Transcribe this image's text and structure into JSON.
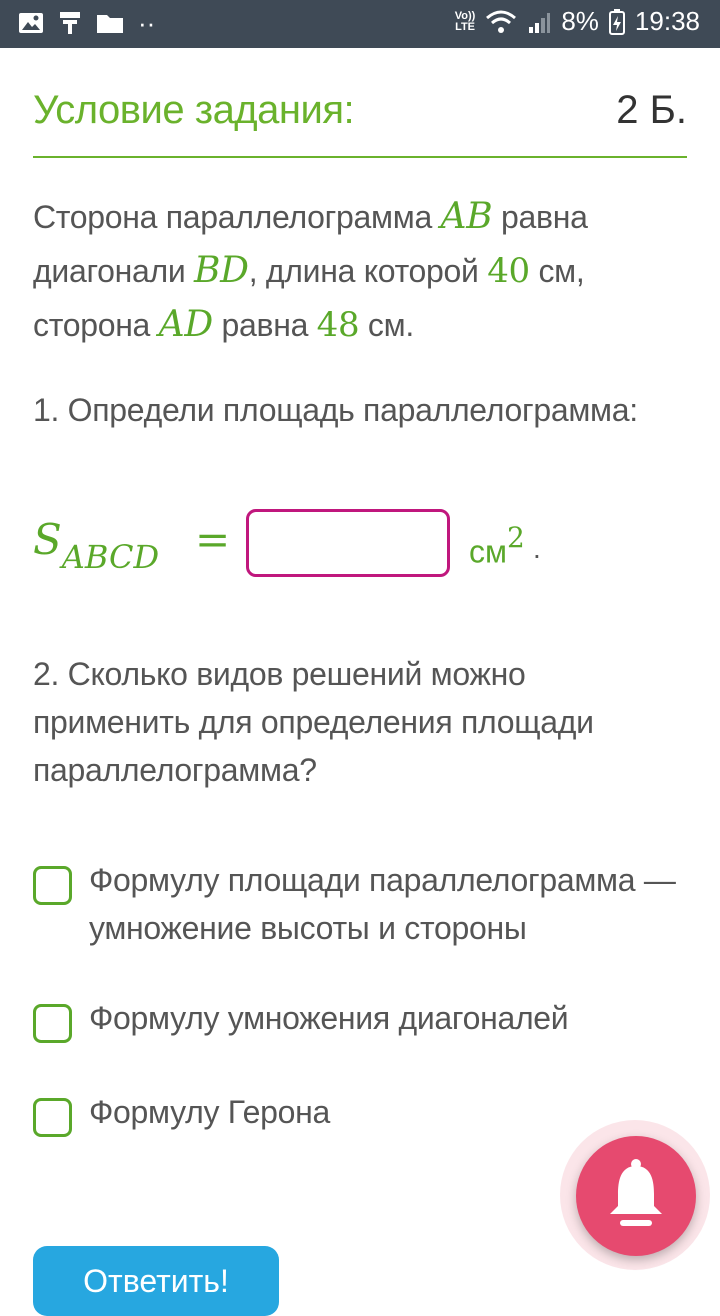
{
  "status_bar": {
    "signal_label_top": "Vo))",
    "signal_label_bottom": "LTE",
    "battery_percent": "8%",
    "time": "19:38",
    "dots": "··"
  },
  "task": {
    "title": "Условие задания:",
    "points": "2 Б."
  },
  "condition": {
    "part1": "Сторона параллелограмма ",
    "ab": "AB",
    "part2": " равна диагонали ",
    "bd": "BD",
    "part3": ", длина которой ",
    "len_bd": "40",
    "part4": " см, сторона ",
    "ad": "AD",
    "part5": " равна ",
    "len_ad": "48",
    "part6": " см."
  },
  "question1": {
    "text": "1. Определи площадь параллелограмма:",
    "s_letter": "S",
    "s_sub": "ABCD",
    "equals": "=",
    "answer_value": "",
    "unit": "см",
    "unit_power": "2",
    "period": "."
  },
  "question2": {
    "text": "2. Сколько видов решений можно применить для определения площади параллелограмма?",
    "options": [
      {
        "label": "Формулу площади параллелограмма — умножение высоты и стороны",
        "checked": false
      },
      {
        "label": "Формулу умножения диагоналей",
        "checked": false
      },
      {
        "label": "Формулу Герона",
        "checked": false
      }
    ]
  },
  "submit": {
    "label": "Ответить!"
  },
  "colors": {
    "accent_green": "#6ab22c",
    "input_border": "#c0177d",
    "bell": "#e64a6f",
    "submit": "#27a7e0",
    "status_bar": "#3f4a56"
  }
}
